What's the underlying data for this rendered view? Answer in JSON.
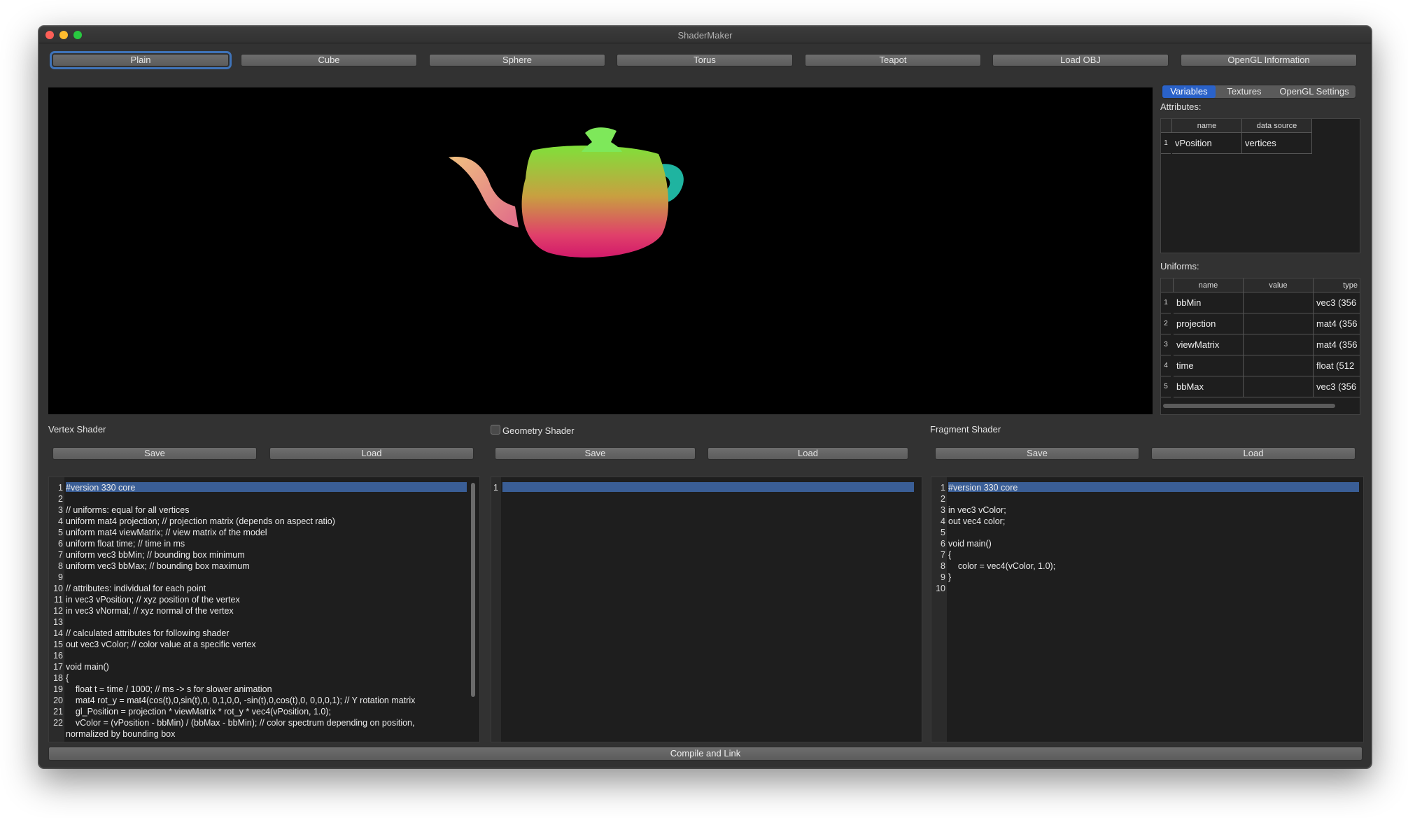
{
  "window": {
    "title": "ShaderMaker"
  },
  "toolbar": [
    "Plain",
    "Cube",
    "Sphere",
    "Torus",
    "Teapot",
    "Load OBJ",
    "OpenGL Information"
  ],
  "tabs": [
    "Variables",
    "Textures",
    "OpenGL Settings"
  ],
  "attributes": {
    "label": "Attributes:",
    "headers": [
      "name",
      "data source"
    ],
    "rows": [
      {
        "n": "1",
        "name": "vPosition",
        "source": "vertices"
      }
    ]
  },
  "uniforms": {
    "label": "Uniforms:",
    "headers": [
      "name",
      "value",
      "type"
    ],
    "rows": [
      {
        "n": "1",
        "name": "bbMin",
        "value": "",
        "type": "vec3 (356"
      },
      {
        "n": "2",
        "name": "projection",
        "value": "",
        "type": "mat4 (356"
      },
      {
        "n": "3",
        "name": "viewMatrix",
        "value": "",
        "type": "mat4 (356"
      },
      {
        "n": "4",
        "name": "time",
        "value": "",
        "type": "float (512"
      },
      {
        "n": "5",
        "name": "bbMax",
        "value": "",
        "type": "vec3 (356"
      }
    ]
  },
  "vertex": {
    "label": "Vertex Shader",
    "save": "Save",
    "load": "Load",
    "lines": [
      "#version 330 core",
      "",
      "// uniforms: equal for all vertices",
      "uniform mat4 projection; // projection matrix (depends on aspect ratio)",
      "uniform mat4 viewMatrix; // view matrix of the model",
      "uniform float time; // time in ms",
      "uniform vec3 bbMin; // bounding box minimum",
      "uniform vec3 bbMax; // bounding box maximum",
      "",
      "// attributes: individual for each point",
      "in vec3 vPosition; // xyz position of the vertex",
      "in vec3 vNormal; // xyz normal of the vertex",
      "",
      "// calculated attributes for following shader",
      "out vec3 vColor; // color value at a specific vertex",
      "",
      "void main()",
      "{",
      "    float t = time / 1000; // ms -> s for slower animation",
      "    mat4 rot_y = mat4(cos(t),0,sin(t),0, 0,1,0,0, -sin(t),0,cos(t),0, 0,0,0,1); // Y rotation matrix",
      "    gl_Position = projection * viewMatrix * rot_y * vec4(vPosition, 1.0);",
      "    vColor = (vPosition - bbMin) / (bbMax - bbMin); // color spectrum depending on position,",
      "normalized by bounding box"
    ]
  },
  "geometry": {
    "label": "Geometry Shader",
    "save": "Save",
    "load": "Load",
    "lines": [
      ""
    ]
  },
  "fragment": {
    "label": "Fragment Shader",
    "save": "Save",
    "load": "Load",
    "lines": [
      "#version 330 core",
      "",
      "in vec3 vColor;",
      "out vec4 color;",
      "",
      "void main()",
      "{",
      "    color = vec4(vColor, 1.0);",
      "}",
      ""
    ]
  },
  "compile": "Compile and Link"
}
